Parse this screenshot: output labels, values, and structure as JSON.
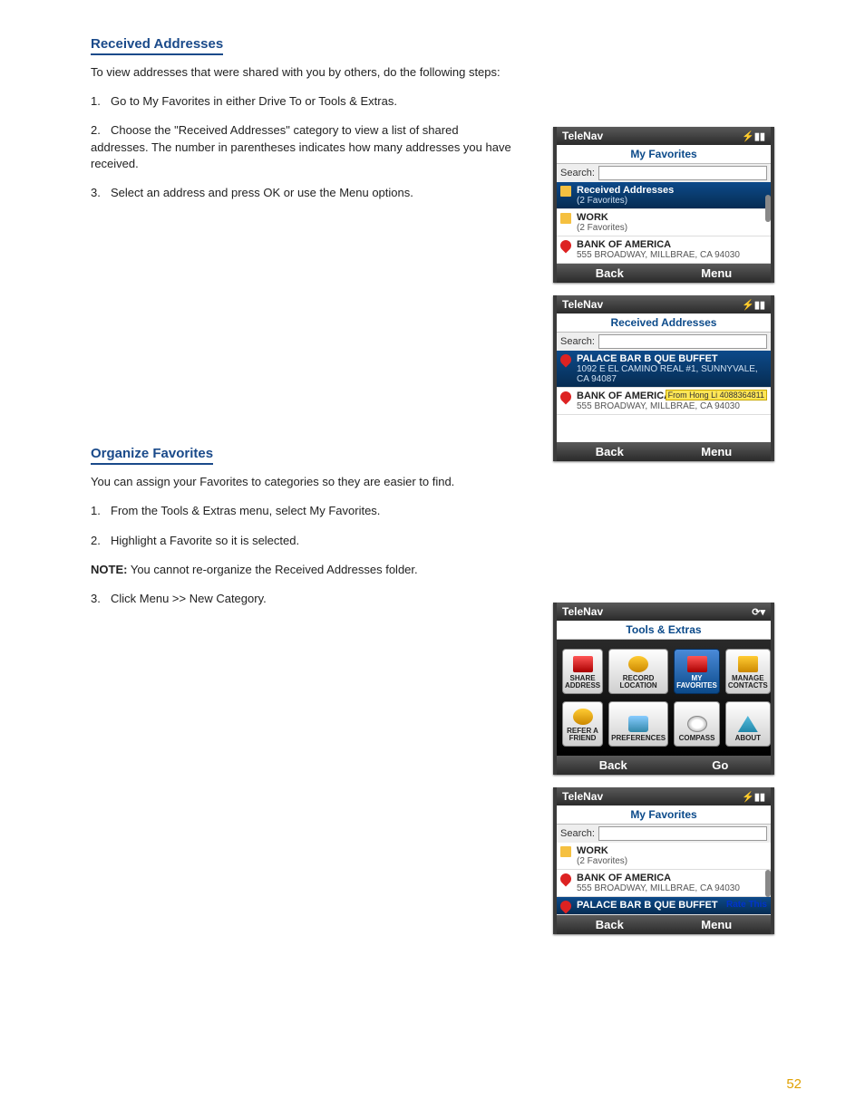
{
  "page_number": "52",
  "left": {
    "sec1": {
      "heading": "Received Addresses",
      "intro": "To view addresses that were shared with you by others, do the following steps:",
      "steps": [
        "Go to My Favorites in either Drive To or Tools & Extras.",
        "Choose the \"Received Addresses\" category to view a list of shared addresses. The number in parentheses indicates how many addresses you have received.",
        "Select an address and press OK or use the Menu options."
      ]
    },
    "sec2": {
      "heading": "Organize Favorites",
      "intro": "You can assign your Favorites to categories so they are easier to find.",
      "steps": [
        "From the Tools & Extras menu, select My Favorites.",
        "Highlight a Favorite so it is selected.",
        "Click Menu >> New Category."
      ],
      "note_label": "NOTE:",
      "note": "You cannot re-organize the Received Addresses folder."
    }
  },
  "phones": {
    "label_search": "Search:",
    "brand": "TeleNav",
    "battery": "⚡▮▮",
    "p1": {
      "subtitle": "My Favorites",
      "rows": [
        {
          "title": "Received Addresses",
          "sub": "(2 Favorites)",
          "icon": "env",
          "sel": true
        },
        {
          "title": "WORK",
          "sub": "(2 Favorites)",
          "icon": "fold",
          "sel": false
        },
        {
          "title": "BANK OF AMERICA",
          "sub": "555 BROADWAY, MILLBRAE, CA 94030",
          "icon": "heart",
          "sel": false
        }
      ],
      "soft": [
        "Back",
        "Menu"
      ]
    },
    "p2": {
      "subtitle": "Received Addresses",
      "rows": [
        {
          "title": "PALACE BAR B QUE BUFFET",
          "sub": "1092 E EL CAMINO REAL #1, SUNNYVALE, CA 94087",
          "icon": "heart",
          "sel": true
        },
        {
          "title": "BANK OF AMERICA",
          "sub": "555 BROADWAY, MILLBRAE, CA 94030",
          "icon": "heart",
          "sel": false,
          "chip": "From Hong Li 4088364811"
        }
      ],
      "soft": [
        "Back",
        "Menu"
      ]
    },
    "p3": {
      "subtitle": "Tools & Extras",
      "grid": [
        {
          "label": "SHARE ADDRESS",
          "icon": "share"
        },
        {
          "label": "RECORD LOCATION",
          "icon": "record"
        },
        {
          "label": "MY FAVORITES",
          "icon": "fav",
          "sel": true
        },
        {
          "label": "MANAGE CONTACTS",
          "icon": "contacts"
        },
        {
          "label": "REFER A FRIEND",
          "icon": "refer"
        },
        {
          "label": "PREFERENCES",
          "icon": "prefs"
        },
        {
          "label": "COMPASS",
          "icon": "compass"
        },
        {
          "label": "ABOUT",
          "icon": "about"
        }
      ],
      "soft": [
        "Back",
        "Go"
      ]
    },
    "p4": {
      "subtitle": "My Favorites",
      "rows": [
        {
          "title": "WORK",
          "sub": "(2 Favorites)",
          "icon": "fold",
          "sel": false
        },
        {
          "title": "BANK OF AMERICA",
          "sub": "555 BROADWAY, MILLBRAE, CA 94030",
          "icon": "heart",
          "sel": false
        },
        {
          "title": "PALACE BAR B QUE BUFFET",
          "sub": "",
          "icon": "heart",
          "sel": true,
          "rate": "Rate This"
        }
      ],
      "soft": [
        "Back",
        "Menu"
      ]
    }
  }
}
